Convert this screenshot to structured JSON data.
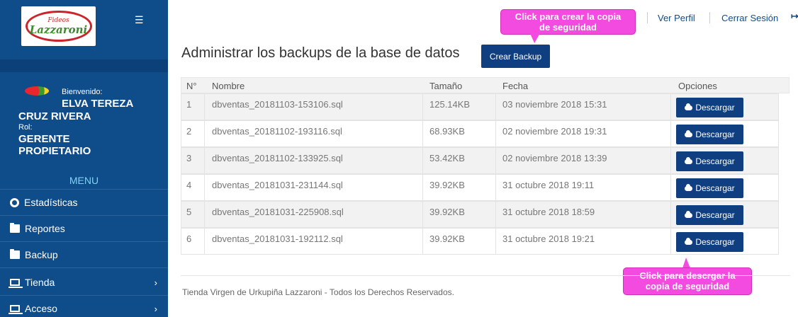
{
  "logo": {
    "small_text": "Fideos",
    "big_text": "Lazzaroni"
  },
  "sidebar": {
    "welcome": "Bienvenido:",
    "user_name_line1": "ELVA TEREZA",
    "user_name_line2": "CRUZ RIVERA",
    "rol_label": "Rol:",
    "rol_line1": "GERENTE",
    "rol_line2": "PROPIETARIO",
    "menu_title": "MENU",
    "items": [
      {
        "label": "Estadísticas",
        "icon": "dashboard-icon"
      },
      {
        "label": "Reportes",
        "icon": "folder-icon"
      },
      {
        "label": "Backup",
        "icon": "folder-icon"
      },
      {
        "label": "Tienda",
        "icon": "laptop-icon"
      },
      {
        "label": "Acceso",
        "icon": "laptop-icon"
      }
    ]
  },
  "header": {
    "ver_perfil": "Ver Perfil",
    "cerrar_sesion": "Cerrar Sesión"
  },
  "main": {
    "title": "Administrar los backups de la base de datos",
    "create_button": "Crear Backup",
    "columns": [
      "N°",
      "Nombre",
      "Tamaño",
      "Fecha",
      "Opciones"
    ],
    "download_label": "Descargar",
    "rows": [
      {
        "n": "1",
        "nombre": "dbventas_20181103-153106.sql",
        "tamano": "125.14KB",
        "fecha": "03 noviembre 2018 15:31"
      },
      {
        "n": "2",
        "nombre": "dbventas_20181102-193116.sql",
        "tamano": "68.93KB",
        "fecha": "02 noviembre 2018 19:31"
      },
      {
        "n": "3",
        "nombre": "dbventas_20181102-133925.sql",
        "tamano": "53.42KB",
        "fecha": "02 noviembre 2018 13:39"
      },
      {
        "n": "4",
        "nombre": "dbventas_20181031-231144.sql",
        "tamano": "39.92KB",
        "fecha": "31 octubre 2018 19:11"
      },
      {
        "n": "5",
        "nombre": "dbventas_20181031-225908.sql",
        "tamano": "39.92KB",
        "fecha": "31 octubre 2018 18:59"
      },
      {
        "n": "6",
        "nombre": "dbventas_20181031-192112.sql",
        "tamano": "39.92KB",
        "fecha": "31 octubre 2018 19:21"
      }
    ]
  },
  "annotations": {
    "create_tip_line1": "Click para crear la copia",
    "create_tip_line2": "de seguridad",
    "download_tip_line1": "Click para descrgar la",
    "download_tip_line2": "copia de seguridad"
  },
  "footer": "Tienda Virgen de Urkupiña Lazzaroni - Todos los Derechos Reservados.",
  "colors": {
    "sidebar": "#0f4c8a",
    "button": "#0f3f80",
    "annotation": "#f34be0",
    "menu_title": "#7fd3f0"
  }
}
